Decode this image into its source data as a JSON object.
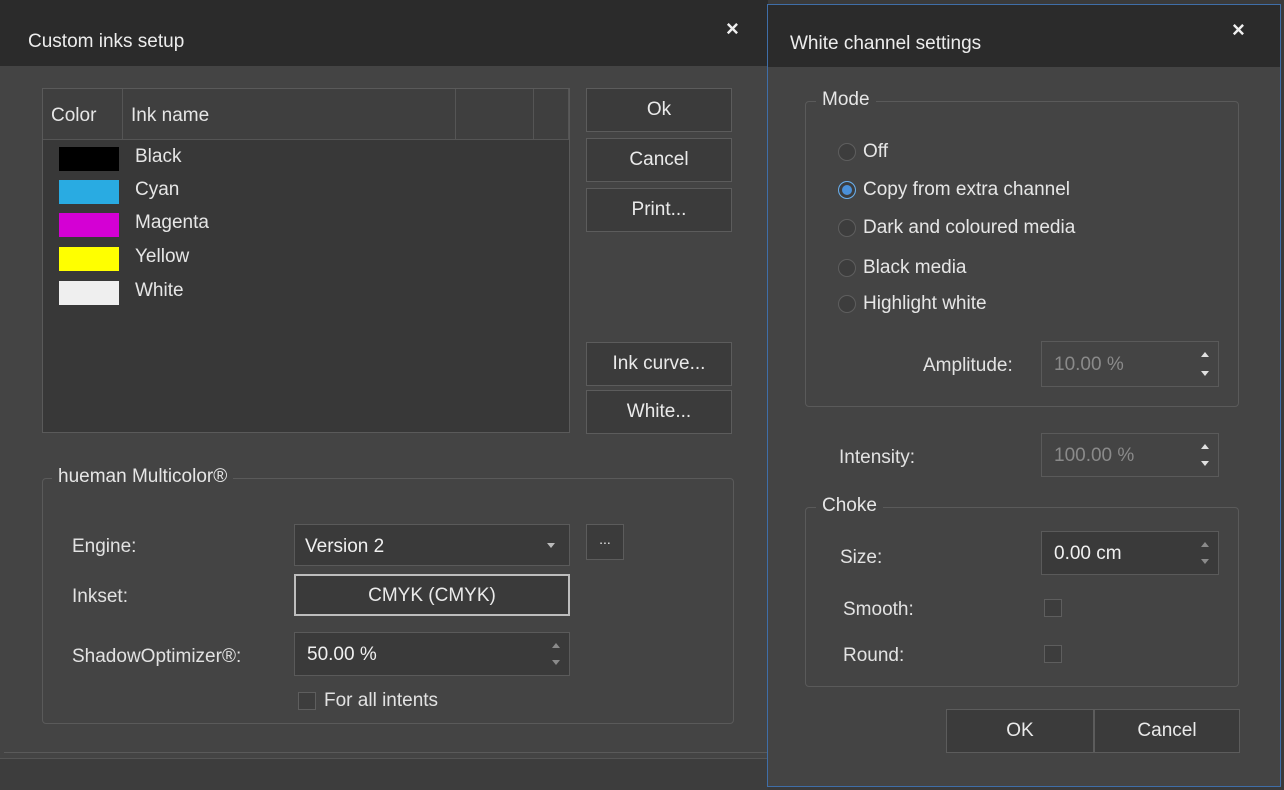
{
  "left_dialog": {
    "title": "Custom inks setup",
    "close_label": "×",
    "ink_table": {
      "headers": [
        "Color",
        "Ink name",
        "",
        ""
      ],
      "rows": [
        {
          "name": "Black",
          "color": "#000000"
        },
        {
          "name": "Cyan",
          "color": "#29abe2"
        },
        {
          "name": "Magenta",
          "color": "#d400d4"
        },
        {
          "name": "Yellow",
          "color": "#ffff00"
        },
        {
          "name": "White",
          "color": "#efefef"
        }
      ]
    },
    "buttons": {
      "ok": "Ok",
      "cancel": "Cancel",
      "print": "Print...",
      "ink_curve": "Ink curve...",
      "white": "White..."
    },
    "multicolor": {
      "group_label": "hueman Multicolor®",
      "engine_label": "Engine:",
      "engine_value": "Version 2",
      "engine_more": "...",
      "inkset_label": "Inkset:",
      "inkset_value": "CMYK (CMYK)",
      "shadow_label": "ShadowOptimizer®:",
      "shadow_value": "50.00 %",
      "for_all_intents_label": "For all intents",
      "for_all_intents_checked": false
    }
  },
  "right_dialog": {
    "title": "White channel settings",
    "close_label": "×",
    "mode": {
      "group_label": "Mode",
      "options": [
        {
          "label": "Off",
          "checked": false
        },
        {
          "label": "Copy from extra channel",
          "checked": true
        },
        {
          "label": "Dark and coloured media",
          "checked": false
        },
        {
          "label": "Black media",
          "checked": false
        },
        {
          "label": "Highlight white",
          "checked": false
        }
      ],
      "amplitude_label": "Amplitude:",
      "amplitude_value": "10.00 %"
    },
    "intensity_label": "Intensity:",
    "intensity_value": "100.00 %",
    "choke": {
      "group_label": "Choke",
      "size_label": "Size:",
      "size_value": "0.00 cm",
      "smooth_label": "Smooth:",
      "smooth_checked": false,
      "round_label": "Round:",
      "round_checked": false
    },
    "buttons": {
      "ok": "OK",
      "cancel": "Cancel"
    }
  },
  "colors": {
    "accent": "#4a90d9",
    "window_border": "#3f6ea8"
  }
}
